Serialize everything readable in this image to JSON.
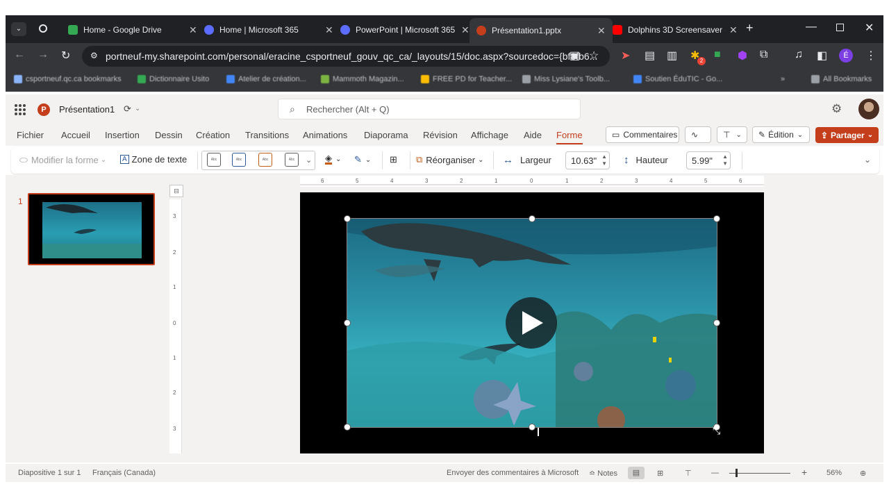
{
  "browser": {
    "tabs": [
      {
        "label": "Home - Google Drive",
        "color": "#34a853"
      },
      {
        "label": "Home | Microsoft 365",
        "color": "#5b6cff"
      },
      {
        "label": "PowerPoint | Microsoft 365",
        "color": "#5b6cff"
      },
      {
        "label": "Présentation1.pptx",
        "color": "#c43e1c"
      },
      {
        "label": "Dolphins 3D Screensaver -",
        "color": "#ff0000"
      }
    ],
    "url": "portneuf-my.sharepoint.com/personal/eracine_csportneuf_gouv_qc_ca/_layouts/15/doc.aspx?sourcedoc={bf8fb6...",
    "extension_badge": "2",
    "profile_initial": "É",
    "bookmarks": [
      "csportneuf.qc.ca bookmarks",
      "Dictionnaire Usito",
      "Atelier de création...",
      "Mammoth Magazin...",
      "FREE PD for Teacher...",
      "Miss Lysiane's Toolb...",
      "Soutien ÉduTIC - Go...",
      "All Bookmarks"
    ]
  },
  "app": {
    "doc_title": "Présentation1",
    "search_placeholder": "Rechercher (Alt + Q)",
    "accent": "#c43e1c"
  },
  "ribbon": {
    "tabs": [
      "Fichier",
      "Accueil",
      "Insertion",
      "Dessin",
      "Création",
      "Transitions",
      "Animations",
      "Diaporama",
      "Révision",
      "Affichage",
      "Aide",
      "Forme"
    ],
    "active_tab": "Forme",
    "comments_label": "Commentaires",
    "edit_label": "Édition",
    "share_label": "Partager"
  },
  "toolbar": {
    "modify_shape": "Modifier la forme",
    "text_box": "Zone de texte",
    "style_sample": "Abc",
    "arrange": "Réorganiser",
    "width_label": "Largeur",
    "width_value": "10.63\"",
    "height_label": "Hauteur",
    "height_value": "5.99\""
  },
  "slides": {
    "current_number": "1"
  },
  "ruler": {
    "horizontal": [
      "6",
      "5",
      "4",
      "3",
      "2",
      "1",
      "0",
      "1",
      "2",
      "3",
      "4",
      "5",
      "6"
    ],
    "vertical": [
      "3",
      "2",
      "1",
      "0",
      "1",
      "2",
      "3"
    ]
  },
  "status": {
    "slide_info": "Diapositive 1 sur 1",
    "language": "Français (Canada)",
    "feedback": "Envoyer des commentaires à Microsoft",
    "notes": "Notes",
    "zoom": "56%"
  }
}
